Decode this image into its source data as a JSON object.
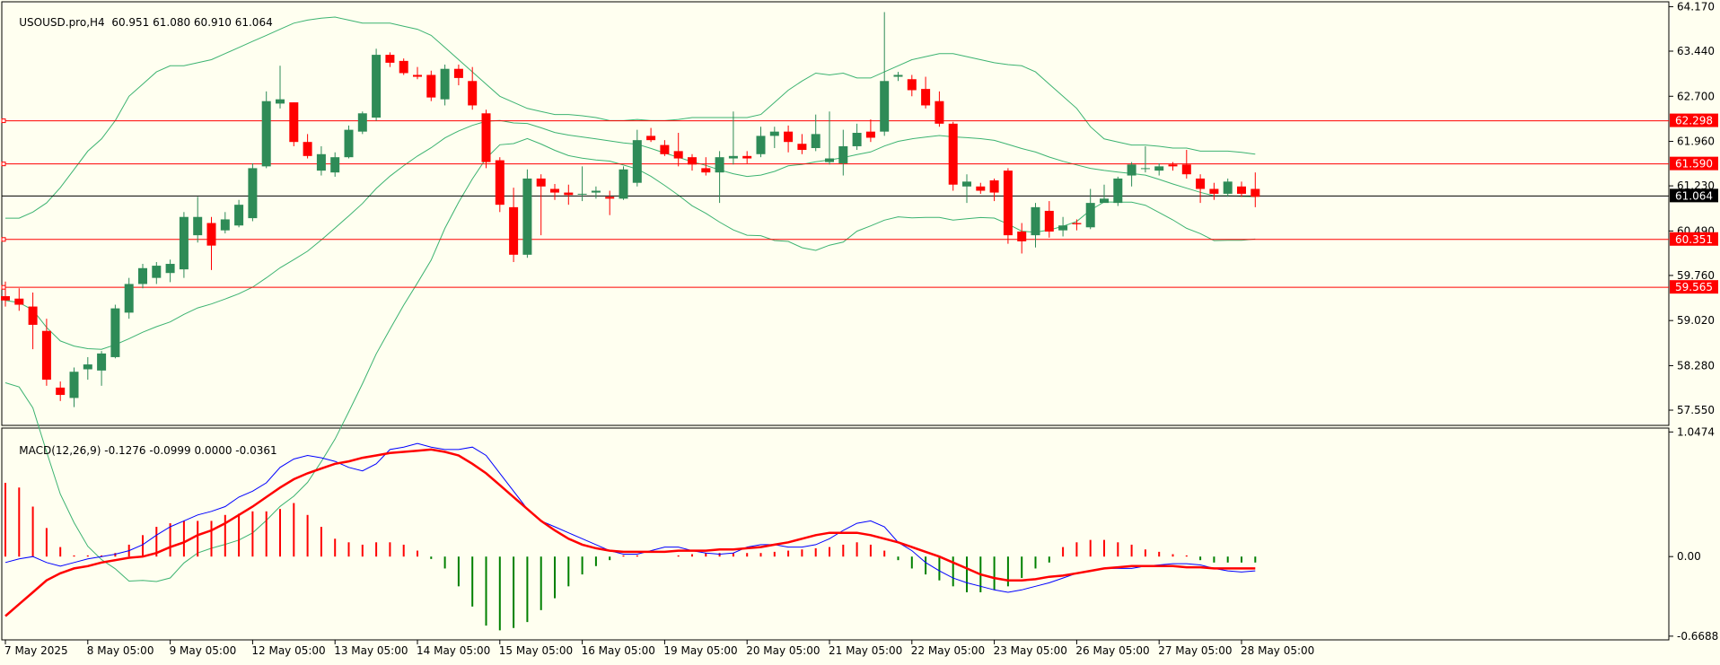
{
  "header": {
    "symbol": "USOUSD.pro,H4",
    "ohlc": "60.951 61.080 60.910 61.064"
  },
  "macd_header": {
    "label": "MACD(12,26,9)",
    "values": "-0.1276 -0.0999 0.0000 -0.0361"
  },
  "colors": {
    "background": "#fffff0",
    "bull": "#2e8b57",
    "bear": "#ff0000",
    "bands": "#3cb371",
    "level": "#ff0000",
    "current_price": "#000000",
    "macd_line": "#0000ff",
    "signal_line": "#ff0000",
    "hist_pos": "#ff0000",
    "hist_neg": "#008000"
  },
  "chart_data": [
    {
      "type": "candlestick",
      "title": "USOUSD.pro,H4",
      "ylim": [
        57.3,
        64.25
      ],
      "price_ticks": [
        "64.170",
        "63.440",
        "62.700",
        "61.960",
        "61.230",
        "60.490",
        "59.760",
        "59.020",
        "58.280",
        "57.550"
      ],
      "time_labels": [
        {
          "label": "7 May 2025",
          "i": 0
        },
        {
          "label": "8 May 05:00",
          "i": 6
        },
        {
          "label": "9 May 05:00",
          "i": 12
        },
        {
          "label": "12 May 05:00",
          "i": 18
        },
        {
          "label": "13 May 05:00",
          "i": 24
        },
        {
          "label": "14 May 05:00",
          "i": 30
        },
        {
          "label": "15 May 05:00",
          "i": 36
        },
        {
          "label": "16 May 05:00",
          "i": 42
        },
        {
          "label": "19 May 05:00",
          "i": 48
        },
        {
          "label": "20 May 05:00",
          "i": 54
        },
        {
          "label": "21 May 05:00",
          "i": 60
        },
        {
          "label": "22 May 05:00",
          "i": 66
        },
        {
          "label": "23 May 05:00",
          "i": 72
        },
        {
          "label": "26 May 05:00",
          "i": 78
        },
        {
          "label": "27 May 05:00",
          "i": 84
        },
        {
          "label": "28 May 05:00",
          "i": 90
        }
      ],
      "candles": [
        [
          59.42,
          59.66,
          59.25,
          59.35
        ],
        [
          59.38,
          59.55,
          59.18,
          59.28
        ],
        [
          59.25,
          59.48,
          58.55,
          58.95
        ],
        [
          58.85,
          59.05,
          57.95,
          58.05
        ],
        [
          57.92,
          58.02,
          57.7,
          57.8
        ],
        [
          57.75,
          58.25,
          57.6,
          58.18
        ],
        [
          58.22,
          58.42,
          58.05,
          58.3
        ],
        [
          58.2,
          58.52,
          57.95,
          58.48
        ],
        [
          58.42,
          59.28,
          58.4,
          59.22
        ],
        [
          59.15,
          59.72,
          59.05,
          59.62
        ],
        [
          59.62,
          59.95,
          59.55,
          59.88
        ],
        [
          59.72,
          59.98,
          59.62,
          59.92
        ],
        [
          59.8,
          60.02,
          59.65,
          59.95
        ],
        [
          59.86,
          60.8,
          59.72,
          60.72
        ],
        [
          60.42,
          61.05,
          60.3,
          60.72
        ],
        [
          60.62,
          60.72,
          59.85,
          60.25
        ],
        [
          60.5,
          60.8,
          60.45,
          60.68
        ],
        [
          60.58,
          61.0,
          60.55,
          60.92
        ],
        [
          60.7,
          61.6,
          60.65,
          61.52
        ],
        [
          61.55,
          62.78,
          61.52,
          62.62
        ],
        [
          62.58,
          63.2,
          62.5,
          62.65
        ],
        [
          62.6,
          62.6,
          61.88,
          61.95
        ],
        [
          61.95,
          62.08,
          61.68,
          61.72
        ],
        [
          61.48,
          61.88,
          61.4,
          61.75
        ],
        [
          61.45,
          61.78,
          61.38,
          61.7
        ],
        [
          61.7,
          62.22,
          61.68,
          62.15
        ],
        [
          62.12,
          62.45,
          62.08,
          62.42
        ],
        [
          62.35,
          63.48,
          62.3,
          63.38
        ],
        [
          63.38,
          63.42,
          63.18,
          63.25
        ],
        [
          63.28,
          63.32,
          63.05,
          63.08
        ],
        [
          63.05,
          63.18,
          62.98,
          63.02
        ],
        [
          63.05,
          63.12,
          62.62,
          62.68
        ],
        [
          62.65,
          63.22,
          62.55,
          63.15
        ],
        [
          63.15,
          63.22,
          62.88,
          63.0
        ],
        [
          62.95,
          63.18,
          62.48,
          62.55
        ],
        [
          62.42,
          62.48,
          61.52,
          61.62
        ],
        [
          61.65,
          61.7,
          60.8,
          60.92
        ],
        [
          60.88,
          61.2,
          59.98,
          60.1
        ],
        [
          60.1,
          61.5,
          60.05,
          61.35
        ],
        [
          61.35,
          61.42,
          60.42,
          61.22
        ],
        [
          61.18,
          61.26,
          61.0,
          61.12
        ],
        [
          61.12,
          61.25,
          60.92,
          61.08
        ],
        [
          61.1,
          61.55,
          60.98,
          61.1
        ],
        [
          61.12,
          61.22,
          61.02,
          61.15
        ],
        [
          61.05,
          61.15,
          60.75,
          61.02
        ],
        [
          61.02,
          61.55,
          61.0,
          61.5
        ],
        [
          61.28,
          62.15,
          61.22,
          61.98
        ],
        [
          62.05,
          62.18,
          61.95,
          61.98
        ],
        [
          61.9,
          61.98,
          61.72,
          61.75
        ],
        [
          61.8,
          62.1,
          61.55,
          61.68
        ],
        [
          61.7,
          61.75,
          61.48,
          61.58
        ],
        [
          61.52,
          61.7,
          61.4,
          61.45
        ],
        [
          61.45,
          61.8,
          60.95,
          61.7
        ],
        [
          61.68,
          62.45,
          61.58,
          61.72
        ],
        [
          61.72,
          61.8,
          61.6,
          61.68
        ],
        [
          61.75,
          62.2,
          61.7,
          62.05
        ],
        [
          62.05,
          62.2,
          61.85,
          62.12
        ],
        [
          62.12,
          62.22,
          61.78,
          61.95
        ],
        [
          61.92,
          62.08,
          61.75,
          61.82
        ],
        [
          61.85,
          62.4,
          61.8,
          62.08
        ],
        [
          61.62,
          62.45,
          61.58,
          61.68
        ],
        [
          61.6,
          62.15,
          61.4,
          61.88
        ],
        [
          61.88,
          62.25,
          61.82,
          62.1
        ],
        [
          62.12,
          62.32,
          61.95,
          62.02
        ],
        [
          62.12,
          64.08,
          62.05,
          62.95
        ],
        [
          63.02,
          63.1,
          62.95,
          63.05
        ],
        [
          62.98,
          63.05,
          62.7,
          62.8
        ],
        [
          62.82,
          63.02,
          62.5,
          62.55
        ],
        [
          62.62,
          62.78,
          62.2,
          62.25
        ],
        [
          62.25,
          62.28,
          61.15,
          61.25
        ],
        [
          61.22,
          61.42,
          60.95,
          61.3
        ],
        [
          61.22,
          61.28,
          61.1,
          61.15
        ],
        [
          61.32,
          61.35,
          60.98,
          61.12
        ],
        [
          61.48,
          61.52,
          60.28,
          60.42
        ],
        [
          60.48,
          60.62,
          60.12,
          60.32
        ],
        [
          60.42,
          60.95,
          60.22,
          60.88
        ],
        [
          60.82,
          60.98,
          60.38,
          60.48
        ],
        [
          60.5,
          60.72,
          60.4,
          60.58
        ],
        [
          60.62,
          60.68,
          60.5,
          60.6
        ],
        [
          60.55,
          61.18,
          60.52,
          60.95
        ],
        [
          60.95,
          61.25,
          60.98,
          61.02
        ],
        [
          60.95,
          61.38,
          60.9,
          61.35
        ],
        [
          61.4,
          61.62,
          61.22,
          61.58
        ],
        [
          61.52,
          61.88,
          61.45,
          61.52
        ],
        [
          61.48,
          61.6,
          61.4,
          61.55
        ],
        [
          61.58,
          61.62,
          61.48,
          61.55
        ],
        [
          61.58,
          61.82,
          61.35,
          61.42
        ],
        [
          61.35,
          61.42,
          60.95,
          61.18
        ],
        [
          61.18,
          61.28,
          61.0,
          61.1
        ],
        [
          61.1,
          61.35,
          61.05,
          61.3
        ],
        [
          61.22,
          61.3,
          61.05,
          61.1
        ],
        [
          61.18,
          61.45,
          60.88,
          61.05
        ]
      ],
      "bollinger": {
        "upper": [
          60.7,
          60.7,
          60.8,
          60.95,
          61.2,
          61.5,
          61.8,
          62.0,
          62.3,
          62.7,
          62.9,
          63.1,
          63.2,
          63.2,
          63.25,
          63.3,
          63.4,
          63.5,
          63.6,
          63.7,
          63.8,
          63.9,
          63.95,
          63.98,
          64.0,
          63.95,
          63.9,
          63.9,
          63.9,
          63.85,
          63.8,
          63.7,
          63.5,
          63.3,
          63.1,
          62.9,
          62.7,
          62.6,
          62.5,
          62.45,
          62.4,
          62.4,
          62.38,
          62.35,
          62.3,
          62.3,
          62.32,
          62.3,
          62.3,
          62.32,
          62.35,
          62.35,
          62.35,
          62.35,
          62.35,
          62.4,
          62.6,
          62.8,
          62.95,
          63.08,
          63.05,
          63.08,
          63.0,
          63.0,
          63.1,
          63.2,
          63.3,
          63.35,
          63.4,
          63.4,
          63.35,
          63.3,
          63.25,
          63.22,
          63.2,
          63.1,
          62.9,
          62.7,
          62.5,
          62.2,
          62.0,
          61.95,
          61.9,
          61.9,
          61.88,
          61.85,
          61.85,
          61.8,
          61.8,
          61.8,
          61.78,
          61.75
        ]
      }
    },
    {
      "type": "macd",
      "title": "MACD(12,26,9)",
      "ylim": [
        -0.7,
        1.08
      ],
      "ticks": [
        "1.0474",
        "0.00",
        "-0.6688"
      ],
      "macd": [
        -0.05,
        -0.02,
        0.0,
        -0.05,
        -0.08,
        -0.05,
        -0.02,
        0.0,
        0.02,
        0.05,
        0.1,
        0.18,
        0.25,
        0.3,
        0.35,
        0.38,
        0.42,
        0.5,
        0.55,
        0.62,
        0.75,
        0.82,
        0.85,
        0.83,
        0.8,
        0.75,
        0.72,
        0.78,
        0.9,
        0.92,
        0.95,
        0.92,
        0.9,
        0.9,
        0.92,
        0.85,
        0.7,
        0.55,
        0.4,
        0.3,
        0.25,
        0.2,
        0.15,
        0.1,
        0.05,
        0.02,
        0.02,
        0.05,
        0.08,
        0.08,
        0.05,
        0.03,
        0.02,
        0.03,
        0.08,
        0.1,
        0.1,
        0.08,
        0.08,
        0.1,
        0.15,
        0.22,
        0.28,
        0.3,
        0.25,
        0.12,
        0.05,
        -0.05,
        -0.12,
        -0.18,
        -0.22,
        -0.25,
        -0.28,
        -0.3,
        -0.28,
        -0.25,
        -0.22,
        -0.18,
        -0.14,
        -0.12,
        -0.1,
        -0.1,
        -0.1,
        -0.08,
        -0.07,
        -0.06,
        -0.06,
        -0.07,
        -0.1,
        -0.12,
        -0.13,
        -0.12
      ],
      "signal": [
        -0.5,
        -0.4,
        -0.3,
        -0.2,
        -0.14,
        -0.1,
        -0.08,
        -0.05,
        -0.03,
        -0.01,
        0.0,
        0.03,
        0.08,
        0.12,
        0.18,
        0.22,
        0.28,
        0.35,
        0.42,
        0.5,
        0.58,
        0.65,
        0.7,
        0.74,
        0.78,
        0.8,
        0.83,
        0.85,
        0.87,
        0.88,
        0.89,
        0.9,
        0.88,
        0.85,
        0.78,
        0.7,
        0.6,
        0.5,
        0.4,
        0.3,
        0.22,
        0.15,
        0.1,
        0.07,
        0.05,
        0.04,
        0.04,
        0.04,
        0.04,
        0.05,
        0.05,
        0.05,
        0.06,
        0.06,
        0.07,
        0.08,
        0.1,
        0.12,
        0.15,
        0.18,
        0.2,
        0.2,
        0.2,
        0.18,
        0.15,
        0.12,
        0.08,
        0.04,
        0.0,
        -0.05,
        -0.1,
        -0.15,
        -0.18,
        -0.2,
        -0.2,
        -0.19,
        -0.17,
        -0.16,
        -0.14,
        -0.12,
        -0.1,
        -0.09,
        -0.08,
        -0.08,
        -0.08,
        -0.08,
        -0.09,
        -0.09,
        -0.1,
        -0.1,
        -0.1,
        -0.1
      ],
      "histogram": [
        0.62,
        0.58,
        0.42,
        0.24,
        0.08,
        0.01,
        0.01,
        0.01,
        0.03,
        0.1,
        0.18,
        0.25,
        0.28,
        0.3,
        0.3,
        0.3,
        0.35,
        0.36,
        0.38,
        0.38,
        0.4,
        0.45,
        0.35,
        0.25,
        0.15,
        0.12,
        0.1,
        0.12,
        0.12,
        0.1,
        0.05,
        -0.02,
        -0.1,
        -0.25,
        -0.42,
        -0.58,
        -0.62,
        -0.6,
        -0.55,
        -0.45,
        -0.35,
        -0.25,
        -0.15,
        -0.08,
        -0.03,
        0.01,
        0.01,
        0.0,
        0.0,
        0.01,
        0.02,
        0.03,
        0.03,
        0.03,
        0.03,
        0.03,
        0.04,
        0.05,
        0.06,
        0.07,
        0.08,
        0.1,
        0.12,
        0.1,
        0.05,
        -0.03,
        -0.1,
        -0.15,
        -0.2,
        -0.25,
        -0.3,
        -0.3,
        -0.28,
        -0.25,
        -0.18,
        -0.1,
        -0.05,
        0.08,
        0.12,
        0.14,
        0.14,
        0.12,
        0.1,
        0.06,
        0.04,
        0.02,
        0.01,
        -0.03,
        -0.05,
        -0.05,
        -0.05,
        -0.05
      ]
    }
  ],
  "levels": [
    {
      "label": "62.298",
      "value": 62.298
    },
    {
      "label": "61.590",
      "value": 61.59
    },
    {
      "label": "60.351",
      "value": 60.351
    },
    {
      "label": "59.565",
      "value": 59.565
    }
  ],
  "current_price": {
    "label": "61.064",
    "value": 61.064
  }
}
